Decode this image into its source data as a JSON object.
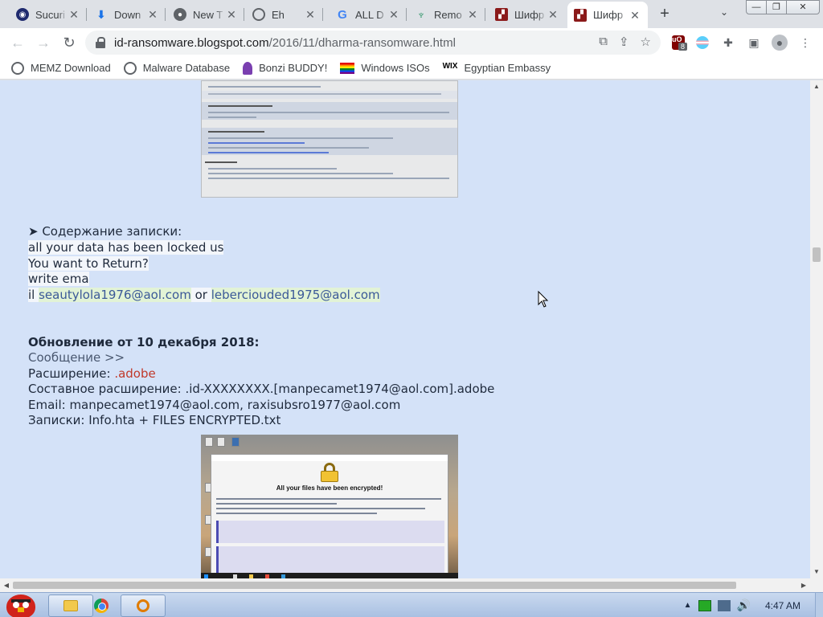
{
  "browser": {
    "tabs": [
      {
        "title": "Sucuri",
        "icon": "sucuri-icon",
        "color": "#1f2a6e",
        "active": false
      },
      {
        "title": "Down",
        "icon": "download-icon",
        "color": "#1a73e8",
        "active": false
      },
      {
        "title": "New T",
        "icon": "chrome-icon",
        "color": "#5f6368",
        "active": false
      },
      {
        "title": "Eh",
        "icon": "globe-icon",
        "color": "#5f6368",
        "active": false
      },
      {
        "title": "ALL D",
        "icon": "google-icon",
        "color": "#4285f4",
        "active": false
      },
      {
        "title": "Remo",
        "icon": "malwarebytes-icon",
        "color": "#1a8c5a",
        "active": false
      },
      {
        "title": "Шифр",
        "icon": "id-ransomware-icon",
        "color": "#8b1a1a",
        "active": false
      },
      {
        "title": "Шифр",
        "icon": "id-ransomware-icon",
        "color": "#8b1a1a",
        "active": true
      }
    ],
    "new_tab_symbol": "+",
    "tab_close_symbol": "✕",
    "window_controls": {
      "minimize": "—",
      "maximize": "❐",
      "close": "✕"
    },
    "url_host": "id-ransomware.blogspot.com",
    "url_path": "/2016/11/dharma-ransomware.html",
    "extension_badge": "8",
    "ublock_label": "uO"
  },
  "bookmarks": [
    {
      "label": "MEMZ Download",
      "icon": "globe-icon"
    },
    {
      "label": "Malware Database",
      "icon": "globe-icon"
    },
    {
      "label": "Bonzi BUDDY!",
      "icon": "bonzi-icon"
    },
    {
      "label": "Windows ISOs",
      "icon": "rainbow-flag-icon"
    },
    {
      "label": "Egyptian Embassy",
      "icon": "wix-icon",
      "icon_text": "WIX"
    }
  ],
  "content": {
    "note_heading": "➤ Содержание записки:",
    "note_lines": [
      "all your data has been locked us",
      "You want to Return?",
      "write ema"
    ],
    "note_email_prefix": "il ",
    "note_email_1": "seautylola1976@aol.com",
    "note_email_sep": " or ",
    "note_email_2": "lebercioudеd1975@aol.com",
    "update_heading": "Обновление от 10 декабря 2018:",
    "message_link": "Сообщение >>",
    "ext_label": "Расширение: ",
    "ext_value": ".adobe",
    "compound_ext": "Составное расширение: .id-XXXXXXXX.[manpecamet1974@aol.com].adobe",
    "emails_line": "Email: manpecamet1974@aol.com, raxisubsro1977@aol.com",
    "notes_line": "Записки: Info.hta + FILES ENCRYPTED.txt",
    "screenshot_heading": "All your files have been encrypted!"
  },
  "taskbar": {
    "clock": "4:47 AM",
    "tray_expand": "▲"
  }
}
